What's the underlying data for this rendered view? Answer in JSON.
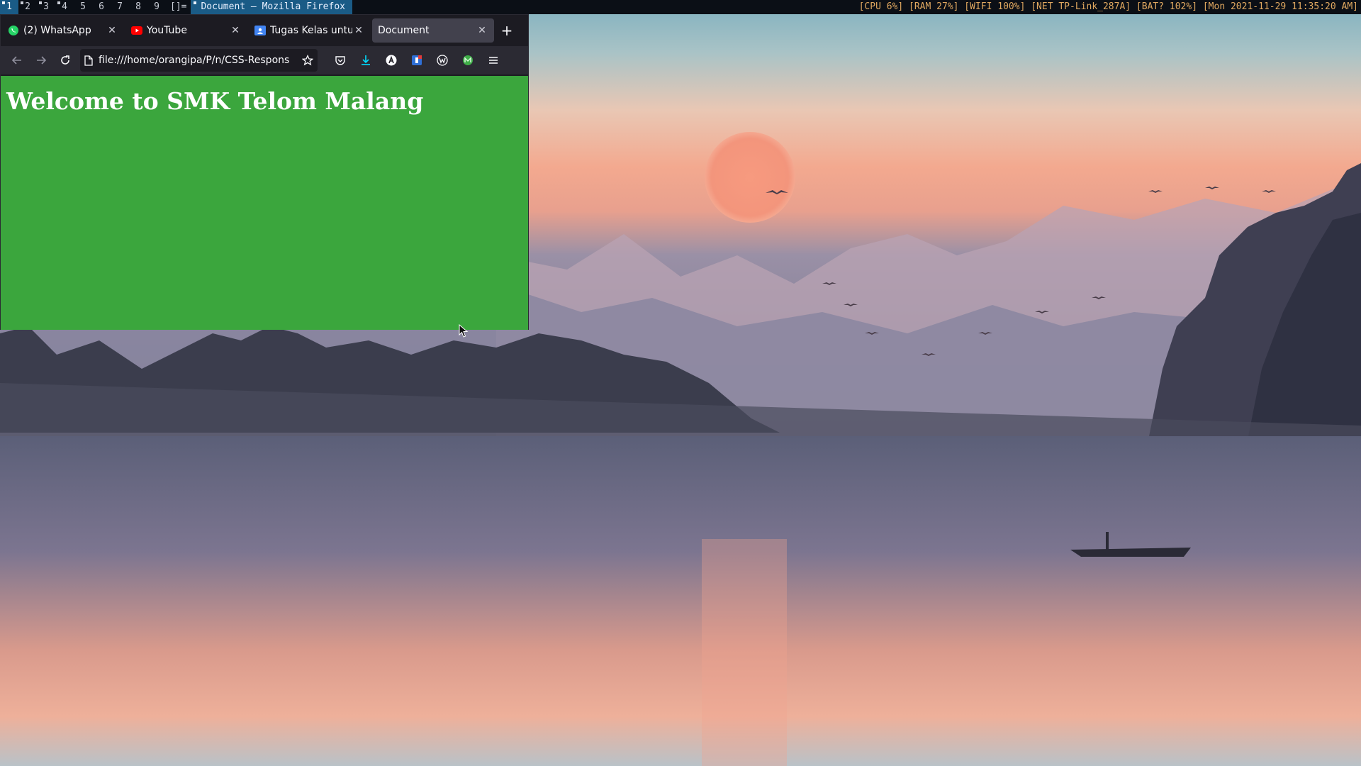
{
  "topbar": {
    "tags": [
      {
        "label": "1",
        "active": true,
        "occupied": true
      },
      {
        "label": "2",
        "active": false,
        "occupied": true
      },
      {
        "label": "3",
        "active": false,
        "occupied": true
      },
      {
        "label": "4",
        "active": false,
        "occupied": true
      },
      {
        "label": "5",
        "active": false,
        "occupied": false
      },
      {
        "label": "6",
        "active": false,
        "occupied": false
      },
      {
        "label": "7",
        "active": false,
        "occupied": false
      },
      {
        "label": "8",
        "active": false,
        "occupied": false
      },
      {
        "label": "9",
        "active": false,
        "occupied": false
      }
    ],
    "layout_symbol": "[]=",
    "window_title": "Document — Mozilla Firefox",
    "status": "[CPU 6%] [RAM 27%] [WIFI 100%] [NET TP-Link_287A] [BAT? 102%] [Mon 2021-11-29 11:35:20 AM]"
  },
  "browser": {
    "tabs": [
      {
        "label": "(2) WhatsApp",
        "icon": "whatsapp-icon",
        "icon_color": "#25d366",
        "selected": false
      },
      {
        "label": "YouTube",
        "icon": "youtube-icon",
        "icon_color": "#ff0000",
        "selected": false
      },
      {
        "label": "Tugas Kelas untuk",
        "icon": "google-classroom-icon",
        "icon_color": "#4285f4",
        "selected": false
      },
      {
        "label": "Document",
        "icon": "",
        "icon_color": "",
        "selected": true
      }
    ],
    "new_tab_label": "+",
    "url": "file:///home/orangipa/P/n/CSS-Respons"
  },
  "page": {
    "heading": "Welcome to SMK Telom Malang",
    "background_color": "#3ba63d"
  },
  "colors": {
    "topbar_accent": "#1a5b86",
    "status_text": "#e0a860",
    "firefox_dark": "#1c1b22"
  }
}
